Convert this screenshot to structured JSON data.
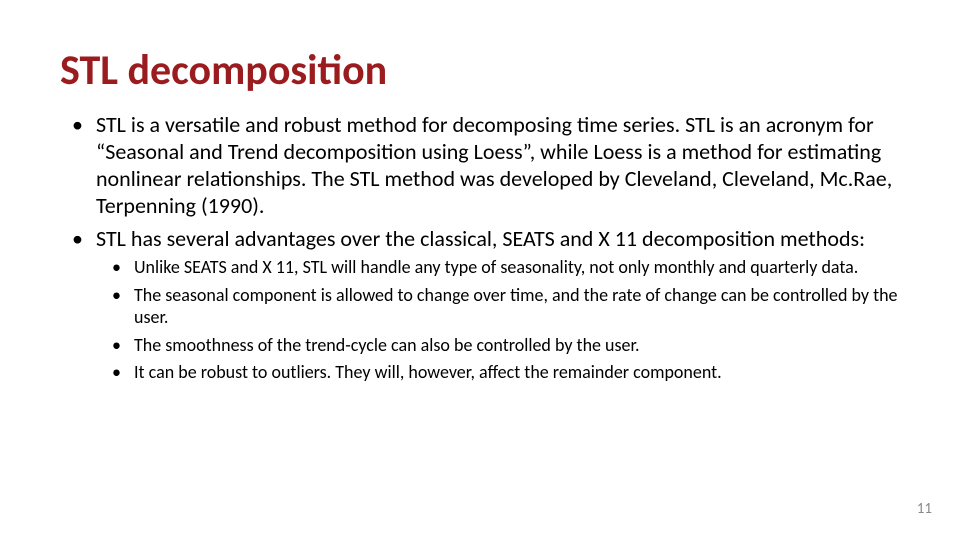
{
  "title": "STL decomposition",
  "bullets": [
    "STL is a versatile and robust method for decomposing time series. STL is an acronym for “Seasonal and Trend decomposition using Loess”, while Loess is a method for estimating nonlinear relationships. The STL method was developed by Cleveland, Cleveland, Mc.Rae, Terpenning (1990).",
    "STL has several advantages over the classical, SEATS and X 11 decomposition methods:"
  ],
  "subbullets": [
    "Unlike SEATS and X 11, STL will handle any type of seasonality, not only monthly and quarterly data.",
    "The seasonal component is allowed to change over time, and the rate of change can be controlled by the user.",
    "The smoothness of the trend-cycle can also be controlled by the user.",
    "It can be robust to outliers. They will, however, affect the remainder component."
  ],
  "page_number": "11"
}
